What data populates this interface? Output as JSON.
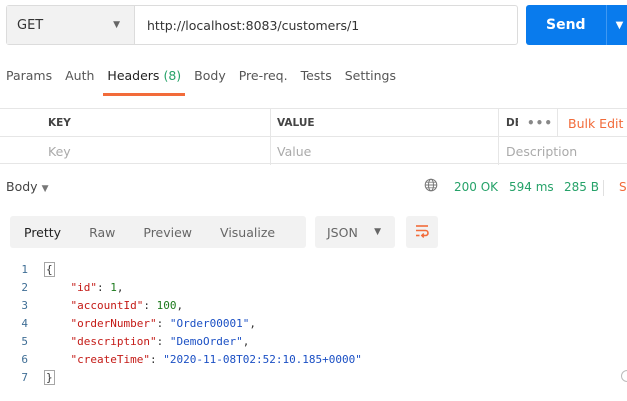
{
  "request": {
    "method": "GET",
    "url": "http://localhost:8083/customers/1",
    "send_label": "Send"
  },
  "tabs": [
    {
      "label": "Params"
    },
    {
      "label": "Auth"
    },
    {
      "label": "Headers",
      "count": "(8)"
    },
    {
      "label": "Body"
    },
    {
      "label": "Pre-req."
    },
    {
      "label": "Tests"
    },
    {
      "label": "Settings"
    }
  ],
  "headers_table": {
    "columns": {
      "key": "KEY",
      "value": "VALUE",
      "description": "DE"
    },
    "more": "•••",
    "bulk_edit": "Bulk Edit",
    "placeholders": {
      "key": "Key",
      "value": "Value",
      "description": "Description"
    }
  },
  "response": {
    "body_label": "Body",
    "status": "200 OK",
    "time": "594 ms",
    "size": "285 B",
    "save_cut": "S"
  },
  "response_toolbar": {
    "views": [
      "Pretty",
      "Raw",
      "Preview",
      "Visualize"
    ],
    "format": "JSON"
  },
  "code_lines": [
    {
      "num": "1",
      "text": "{"
    },
    {
      "num": "2",
      "key": "\"id\"",
      "value": "1",
      "value_type": "number",
      "trail": ","
    },
    {
      "num": "3",
      "key": "\"accountId\"",
      "value": "100",
      "value_type": "number",
      "trail": ","
    },
    {
      "num": "4",
      "key": "\"orderNumber\"",
      "value": "\"Order00001\"",
      "value_type": "string",
      "trail": ","
    },
    {
      "num": "5",
      "key": "\"description\"",
      "value": "\"DemoOrder\"",
      "value_type": "string",
      "trail": ","
    },
    {
      "num": "6",
      "key": "\"createTime\"",
      "value": "\"2020-11-08T02:52:10.185+0000\"",
      "value_type": "string",
      "trail": ""
    },
    {
      "num": "7",
      "text": "}"
    }
  ],
  "colors": {
    "send": "#097bed",
    "accent": "#f26b3a",
    "status_ok": "#26a269",
    "json_key": "#c41a16",
    "json_string": "#1a4fc4",
    "json_number": "#1c7a1c"
  }
}
